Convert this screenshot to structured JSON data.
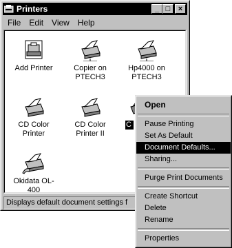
{
  "window": {
    "title": "Printers",
    "buttons": {
      "minimize": "_",
      "maximize": "□",
      "close": "×"
    }
  },
  "menubar": [
    "File",
    "Edit",
    "View",
    "Help"
  ],
  "printers": [
    {
      "label": "Add Printer",
      "icon": "add-printer-icon"
    },
    {
      "label": "Copier on PTECH3",
      "icon": "network-printer-icon"
    },
    {
      "label": "Hp4000 on PTECH3",
      "icon": "network-printer-icon"
    },
    {
      "label": "CD Color Printer",
      "icon": "printer-icon"
    },
    {
      "label": "CD Color Printer II",
      "icon": "printer-icon"
    },
    {
      "label": "C",
      "icon": "printer-icon",
      "selected": true
    },
    {
      "label": "Okidata OL-400",
      "icon": "shared-printer-icon"
    }
  ],
  "statusbar": {
    "text": "Displays default document settings f"
  },
  "context_menu": {
    "items": [
      {
        "label": "Open",
        "default": true
      },
      {
        "sep": true
      },
      {
        "label": "Pause Printing"
      },
      {
        "label": "Set As Default"
      },
      {
        "label": "Document Defaults...",
        "highlighted": true
      },
      {
        "label": "Sharing..."
      },
      {
        "sep": true
      },
      {
        "label": "Purge Print Documents"
      },
      {
        "sep": true
      },
      {
        "label": "Create Shortcut"
      },
      {
        "label": "Delete"
      },
      {
        "label": "Rename"
      },
      {
        "sep": true
      },
      {
        "label": "Properties"
      }
    ]
  },
  "colors": {
    "face": "#c0c0c0",
    "highlight": "#000000",
    "titlebar": "#000000"
  }
}
